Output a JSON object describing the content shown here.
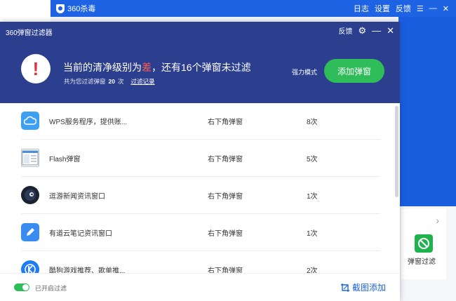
{
  "background_app": {
    "title": "360杀毒",
    "menu": [
      "日志",
      "设置",
      "反馈"
    ],
    "tool_label": "弹窗过滤"
  },
  "dialog": {
    "title": "360弹窗过滤器",
    "feedback_label": "反馈",
    "headline_prefix": "当前的清净级别为",
    "headline_level": "差",
    "headline_suffix": "，还有16个弹窗未过滤",
    "sub_prefix": "共为您过滤弹窗",
    "sub_count": "20",
    "sub_unit": "次",
    "history_link": "过滤记录",
    "mode_label": "强力模式",
    "add_button": "添加弹窗",
    "rows": [
      {
        "name": "WPS服务程序，提供账...",
        "type": "右下角弹窗",
        "count": "8次",
        "icon": "wps-cloud-icon"
      },
      {
        "name": "Flash弹窗",
        "type": "右下角弹窗",
        "count": "5次",
        "icon": "flash-window-icon"
      },
      {
        "name": "逗游新闻资讯窗口",
        "type": "右下角弹窗",
        "count": "1次",
        "icon": "douyou-icon"
      },
      {
        "name": "有道云笔记资讯窗口",
        "type": "右下角弹窗",
        "count": "1次",
        "icon": "youdao-note-icon"
      },
      {
        "name": "酷狗游戏推荐、歌单推...",
        "type": "右下角弹窗",
        "count": "2次",
        "icon": "kugou-icon"
      }
    ],
    "toggle_label": "已开启过滤",
    "screenshot_add": "截图添加"
  },
  "colors": {
    "header_bg": "#2c3f8e",
    "accent_green": "#2ebd59",
    "brand_blue": "#1d63e4",
    "alert_red": "#e0323a"
  }
}
